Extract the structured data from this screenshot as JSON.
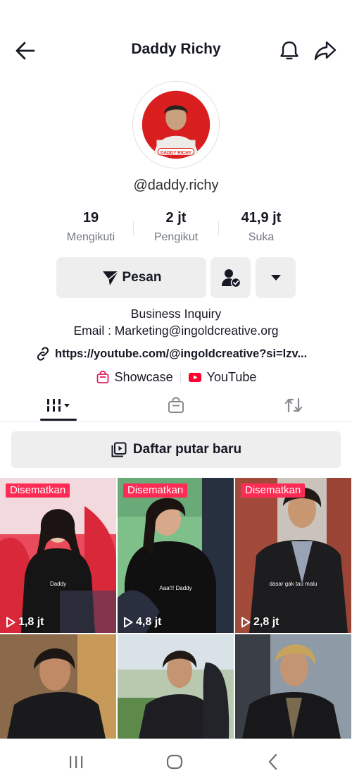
{
  "header": {
    "title": "Daddy Richy",
    "back_icon": "arrow-left-icon",
    "bell_icon": "bell-icon",
    "share_icon": "share-arrow-icon"
  },
  "profile": {
    "avatar_badge": "DADDY RICHY",
    "handle": "@daddy.richy"
  },
  "stats": [
    {
      "value": "19",
      "label": "Mengikuti"
    },
    {
      "value": "2 jt",
      "label": "Pengikut"
    },
    {
      "value": "41,9 jt",
      "label": "Suka"
    }
  ],
  "actions": {
    "message_label": "Pesan",
    "friend_icon": "person-check-icon",
    "more_icon": "caret-down-icon"
  },
  "bio": {
    "line1": "Business Inquiry",
    "line2": "Email : Marketing@ingoldcreative.org",
    "link": "https://youtube.com/@ingoldcreative?si=lzv..."
  },
  "chips": [
    {
      "label": "Showcase",
      "icon": "shop-bag-icon"
    },
    {
      "label": "YouTube",
      "icon": "youtube-icon"
    }
  ],
  "tabs": {
    "grid_icon": "videos-grid-icon",
    "shop_icon": "shop-bag-icon",
    "repost_icon": "repost-icon"
  },
  "playlist": {
    "label": "Daftar putar baru"
  },
  "videos": [
    {
      "pinned_label": "Disematkan",
      "views": "1,8 jt",
      "caption": "Daddy"
    },
    {
      "pinned_label": "Disematkan",
      "views": "4,8 jt",
      "caption": "Aaa!!! Daddy"
    },
    {
      "pinned_label": "Disematkan",
      "views": "2,8 jt",
      "caption": "dasar gak tau malu"
    },
    {
      "pinned_label": "",
      "views": "",
      "caption": ""
    },
    {
      "pinned_label": "",
      "views": "",
      "caption": ""
    },
    {
      "pinned_label": "",
      "views": "",
      "caption": ""
    }
  ],
  "colors": {
    "accent": "#fe2c55",
    "text": "#161823",
    "muted": "#737880",
    "button_bg": "#eeeeef"
  }
}
